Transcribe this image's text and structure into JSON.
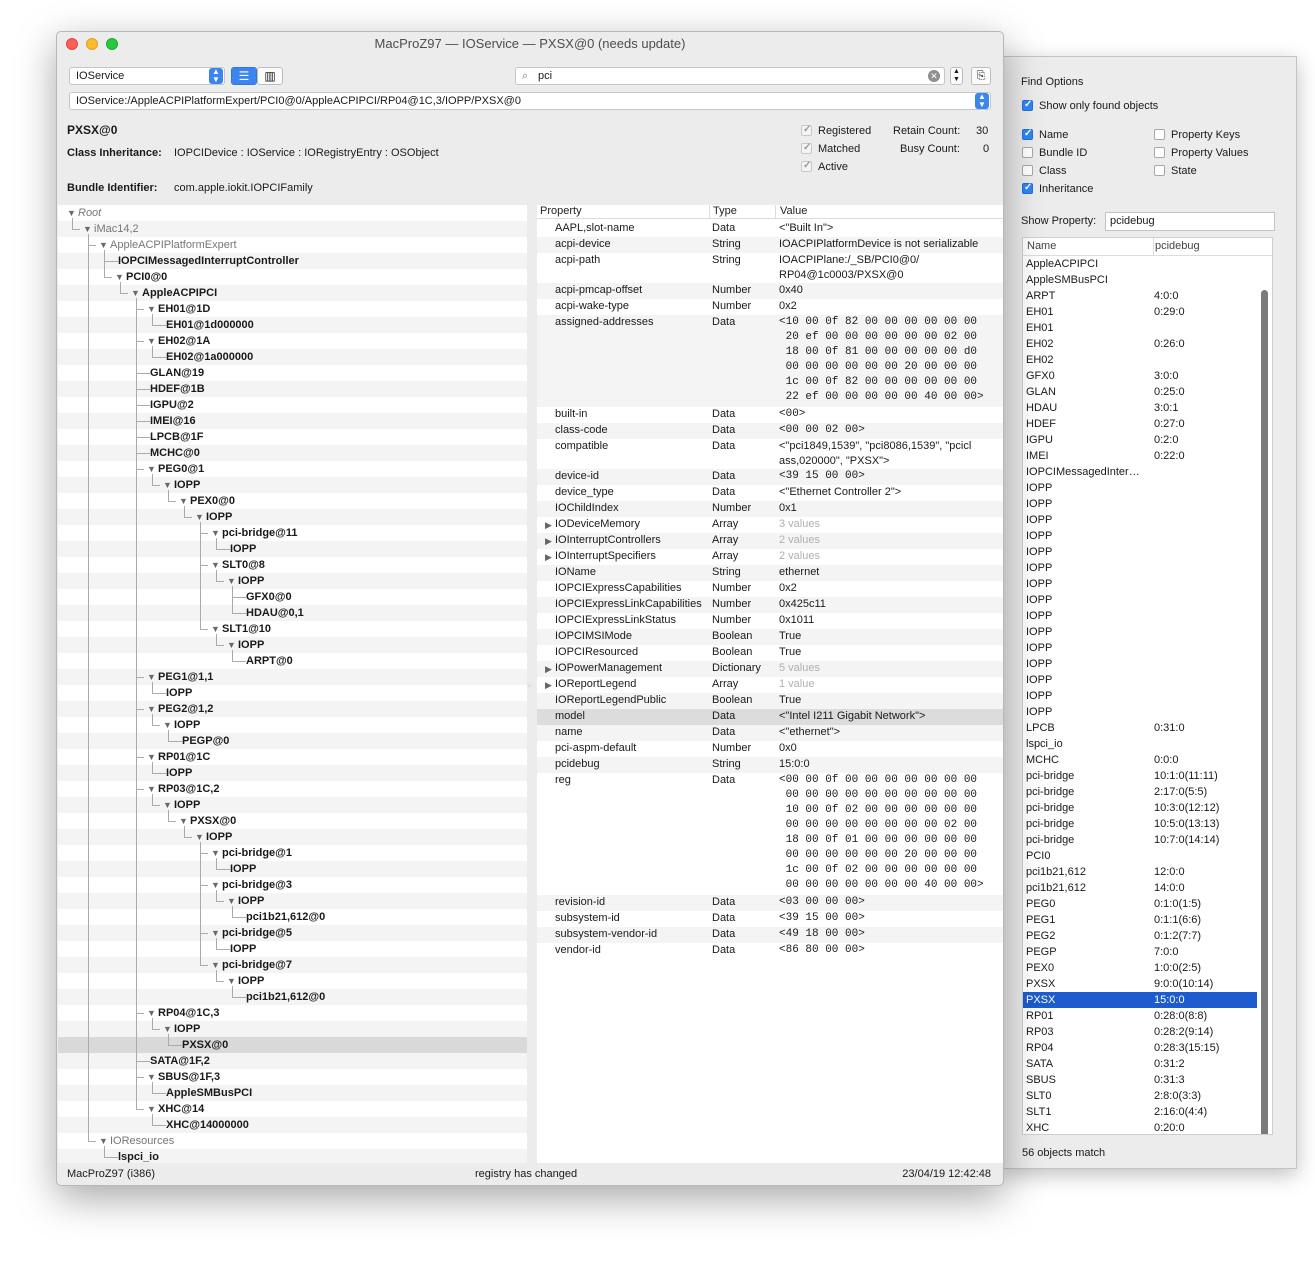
{
  "window": {
    "title": "MacProZ97 — IOService — PXSX@0 (needs update)",
    "plane": "IOService",
    "search": "pci",
    "path": "IOService:/AppleACPIPlatformExpert/PCI0@0/AppleACPIPCI/RP04@1C,3/IOPP/PXSX@0"
  },
  "info": {
    "name": "PXSX@0",
    "inheritance_label": "Class Inheritance:",
    "inheritance": "IOPCIDevice : IOService : IORegistryEntry : OSObject",
    "bundle_label": "Bundle Identifier:",
    "bundle": "com.apple.iokit.IOPCIFamily",
    "registered": "Registered",
    "matched": "Matched",
    "active": "Active",
    "retain_label": "Retain Count:",
    "retain": "30",
    "busy_label": "Busy Count:",
    "busy": "0"
  },
  "tree": [
    {
      "label": "Root",
      "style": "i",
      "indent": 0,
      "open": true
    },
    {
      "label": "iMac14,2",
      "style": "g",
      "indent": 1,
      "open": true
    },
    {
      "label": "AppleACPIPlatformExpert",
      "style": "g",
      "indent": 2,
      "open": true
    },
    {
      "label": "IOPCIMessagedInterruptController",
      "style": "b",
      "indent": 3,
      "open": null
    },
    {
      "label": "PCI0@0",
      "style": "b",
      "indent": 3,
      "open": true
    },
    {
      "label": "AppleACPIPCI",
      "style": "b",
      "indent": 4,
      "open": true
    },
    {
      "label": "EH01@1D",
      "style": "b",
      "indent": 5,
      "open": true
    },
    {
      "label": "EH01@1d000000",
      "style": "b",
      "indent": 6,
      "open": null
    },
    {
      "label": "EH02@1A",
      "style": "b",
      "indent": 5,
      "open": true
    },
    {
      "label": "EH02@1a000000",
      "style": "b",
      "indent": 6,
      "open": null
    },
    {
      "label": "GLAN@19",
      "style": "b",
      "indent": 5,
      "open": null
    },
    {
      "label": "HDEF@1B",
      "style": "b",
      "indent": 5,
      "open": null
    },
    {
      "label": "IGPU@2",
      "style": "b",
      "indent": 5,
      "open": null
    },
    {
      "label": "IMEI@16",
      "style": "b",
      "indent": 5,
      "open": null
    },
    {
      "label": "LPCB@1F",
      "style": "b",
      "indent": 5,
      "open": null
    },
    {
      "label": "MCHC@0",
      "style": "b",
      "indent": 5,
      "open": null
    },
    {
      "label": "PEG0@1",
      "style": "b",
      "indent": 5,
      "open": true
    },
    {
      "label": "IOPP",
      "style": "b",
      "indent": 6,
      "open": true
    },
    {
      "label": "PEX0@0",
      "style": "b",
      "indent": 7,
      "open": true
    },
    {
      "label": "IOPP",
      "style": "b",
      "indent": 8,
      "open": true
    },
    {
      "label": "pci-bridge@11",
      "style": "b",
      "indent": 9,
      "open": true
    },
    {
      "label": "IOPP",
      "style": "b",
      "indent": 10,
      "open": null
    },
    {
      "label": "SLT0@8",
      "style": "b",
      "indent": 9,
      "open": true
    },
    {
      "label": "IOPP",
      "style": "b",
      "indent": 10,
      "open": true
    },
    {
      "label": "GFX0@0",
      "style": "b",
      "indent": 11,
      "open": null
    },
    {
      "label": "HDAU@0,1",
      "style": "b",
      "indent": 11,
      "open": null
    },
    {
      "label": "SLT1@10",
      "style": "b",
      "indent": 9,
      "open": true
    },
    {
      "label": "IOPP",
      "style": "b",
      "indent": 10,
      "open": true
    },
    {
      "label": "ARPT@0",
      "style": "b",
      "indent": 11,
      "open": null
    },
    {
      "label": "PEG1@1,1",
      "style": "b",
      "indent": 5,
      "open": true
    },
    {
      "label": "IOPP",
      "style": "b",
      "indent": 6,
      "open": null
    },
    {
      "label": "PEG2@1,2",
      "style": "b",
      "indent": 5,
      "open": true
    },
    {
      "label": "IOPP",
      "style": "b",
      "indent": 6,
      "open": true
    },
    {
      "label": "PEGP@0",
      "style": "b",
      "indent": 7,
      "open": null
    },
    {
      "label": "RP01@1C",
      "style": "b",
      "indent": 5,
      "open": true
    },
    {
      "label": "IOPP",
      "style": "b",
      "indent": 6,
      "open": null
    },
    {
      "label": "RP03@1C,2",
      "style": "b",
      "indent": 5,
      "open": true
    },
    {
      "label": "IOPP",
      "style": "b",
      "indent": 6,
      "open": true
    },
    {
      "label": "PXSX@0",
      "style": "b",
      "indent": 7,
      "open": true
    },
    {
      "label": "IOPP",
      "style": "b",
      "indent": 8,
      "open": true
    },
    {
      "label": "pci-bridge@1",
      "style": "b",
      "indent": 9,
      "open": true
    },
    {
      "label": "IOPP",
      "style": "b",
      "indent": 10,
      "open": null
    },
    {
      "label": "pci-bridge@3",
      "style": "b",
      "indent": 9,
      "open": true
    },
    {
      "label": "IOPP",
      "style": "b",
      "indent": 10,
      "open": true
    },
    {
      "label": "pci1b21,612@0",
      "style": "b",
      "indent": 11,
      "open": null
    },
    {
      "label": "pci-bridge@5",
      "style": "b",
      "indent": 9,
      "open": true
    },
    {
      "label": "IOPP",
      "style": "b",
      "indent": 10,
      "open": null
    },
    {
      "label": "pci-bridge@7",
      "style": "b",
      "indent": 9,
      "open": true
    },
    {
      "label": "IOPP",
      "style": "b",
      "indent": 10,
      "open": true
    },
    {
      "label": "pci1b21,612@0",
      "style": "b",
      "indent": 11,
      "open": null
    },
    {
      "label": "RP04@1C,3",
      "style": "b",
      "indent": 5,
      "open": true
    },
    {
      "label": "IOPP",
      "style": "b",
      "indent": 6,
      "open": true
    },
    {
      "label": "PXSX@0",
      "style": "b",
      "indent": 7,
      "open": null,
      "selected": true
    },
    {
      "label": "SATA@1F,2",
      "style": "b",
      "indent": 5,
      "open": null
    },
    {
      "label": "SBUS@1F,3",
      "style": "b",
      "indent": 5,
      "open": true
    },
    {
      "label": "AppleSMBusPCI",
      "style": "b",
      "indent": 6,
      "open": null
    },
    {
      "label": "XHC@14",
      "style": "b",
      "indent": 5,
      "open": true
    },
    {
      "label": "XHC@14000000",
      "style": "b",
      "indent": 6,
      "open": null
    },
    {
      "label": "IOResources",
      "style": "g",
      "indent": 2,
      "open": true
    },
    {
      "label": "lspci_io",
      "style": "b",
      "indent": 3,
      "open": null
    }
  ],
  "props_header": {
    "property": "Property",
    "type": "Type",
    "value": "Value"
  },
  "props": [
    {
      "k": "AAPL,slot-name",
      "t": "Data",
      "v": "<\"Built In\">",
      "s": 1,
      "lines": 1
    },
    {
      "k": "acpi-device",
      "t": "String",
      "v": "IOACPIPlatformDevice is not serializable",
      "s": 1,
      "lines": 1
    },
    {
      "k": "acpi-path",
      "t": "String",
      "v": "IOACPIPlane:/_SB/PCI0@0/\nRP04@1c0003/PXSX@0",
      "s": 1,
      "lines": 2
    },
    {
      "k": "acpi-pmcap-offset",
      "t": "Number",
      "v": "0x40",
      "s": 1,
      "lines": 1
    },
    {
      "k": "acpi-wake-type",
      "t": "Number",
      "v": "0x2",
      "s": 1,
      "lines": 1
    },
    {
      "k": "assigned-addresses",
      "t": "Data",
      "v": "<10 00 0f 82 00 00 00 00 00 00\n 20 ef 00 00 00 00 00 00 02 00\n 18 00 0f 81 00 00 00 00 00 d0\n 00 00 00 00 00 00 20 00 00 00\n 1c 00 0f 82 00 00 00 00 00 00\n 22 ef 00 00 00 00 00 40 00 00>",
      "s": 0,
      "lines": 6,
      "pad": 1
    },
    {
      "k": "built-in",
      "t": "Data",
      "v": "<00>",
      "s": 0,
      "lines": 1
    },
    {
      "k": "class-code",
      "t": "Data",
      "v": "<00 00 02 00>",
      "s": 0,
      "lines": 1
    },
    {
      "k": "compatible",
      "t": "Data",
      "v": "<\"pci1849,1539\", \"pci8086,1539\", \"pcicl\nass,020000\", \"PXSX\">",
      "s": 1,
      "lines": 2
    },
    {
      "k": "device-id",
      "t": "Data",
      "v": "<39 15 00 00>",
      "s": 0,
      "lines": 1
    },
    {
      "k": "device_type",
      "t": "Data",
      "v": "<\"Ethernet Controller 2\">",
      "s": 1,
      "lines": 1
    },
    {
      "k": "IOChildIndex",
      "t": "Number",
      "v": "0x1",
      "s": 1,
      "lines": 1
    },
    {
      "k": "IODeviceMemory",
      "t": "Array",
      "v": "3 values",
      "s": 2,
      "lines": 1,
      "expand": true
    },
    {
      "k": "IOInterruptControllers",
      "t": "Array",
      "v": "2 values",
      "s": 2,
      "lines": 1,
      "expand": true
    },
    {
      "k": "IOInterruptSpecifiers",
      "t": "Array",
      "v": "2 values",
      "s": 2,
      "lines": 1,
      "expand": true
    },
    {
      "k": "IOName",
      "t": "String",
      "v": "ethernet",
      "s": 1,
      "lines": 1
    },
    {
      "k": "IOPCIExpressCapabilities",
      "t": "Number",
      "v": "0x2",
      "s": 1,
      "lines": 1
    },
    {
      "k": "IOPCIExpressLinkCapabilities",
      "t": "Number",
      "v": "0x425c11",
      "s": 1,
      "lines": 1
    },
    {
      "k": "IOPCIExpressLinkStatus",
      "t": "Number",
      "v": "0x1011",
      "s": 1,
      "lines": 1
    },
    {
      "k": "IOPCIMSIMode",
      "t": "Boolean",
      "v": "True",
      "s": 1,
      "lines": 1
    },
    {
      "k": "IOPCIResourced",
      "t": "Boolean",
      "v": "True",
      "s": 1,
      "lines": 1
    },
    {
      "k": "IOPowerManagement",
      "t": "Dictionary",
      "v": "5 values",
      "s": 2,
      "lines": 1,
      "expand": true
    },
    {
      "k": "IOReportLegend",
      "t": "Array",
      "v": "1 value",
      "s": 2,
      "lines": 1,
      "expand": true
    },
    {
      "k": "IOReportLegendPublic",
      "t": "Boolean",
      "v": "True",
      "s": 1,
      "lines": 1
    },
    {
      "k": "model",
      "t": "Data",
      "v": "<\"Intel I211 Gigabit Network\">",
      "s": 1,
      "lines": 1,
      "hl": true
    },
    {
      "k": "name",
      "t": "Data",
      "v": "<\"ethernet\">",
      "s": 1,
      "lines": 1
    },
    {
      "k": "pci-aspm-default",
      "t": "Number",
      "v": "0x0",
      "s": 1,
      "lines": 1
    },
    {
      "k": "pcidebug",
      "t": "String",
      "v": "15:0:0",
      "s": 1,
      "lines": 1
    },
    {
      "k": "reg",
      "t": "Data",
      "v": "<00 00 0f 00 00 00 00 00 00 00\n 00 00 00 00 00 00 00 00 00 00\n 10 00 0f 02 00 00 00 00 00 00\n 00 00 00 00 00 00 00 00 02 00\n 18 00 0f 01 00 00 00 00 00 00\n 00 00 00 00 00 00 20 00 00 00\n 1c 00 0f 02 00 00 00 00 00 00\n 00 00 00 00 00 00 00 40 00 00>",
      "s": 0,
      "lines": 8,
      "pad": 1
    },
    {
      "k": "revision-id",
      "t": "Data",
      "v": "<03 00 00 00>",
      "s": 0,
      "lines": 1
    },
    {
      "k": "subsystem-id",
      "t": "Data",
      "v": "<39 15 00 00>",
      "s": 0,
      "lines": 1
    },
    {
      "k": "subsystem-vendor-id",
      "t": "Data",
      "v": "<49 18 00 00>",
      "s": 0,
      "lines": 1
    },
    {
      "k": "vendor-id",
      "t": "Data",
      "v": "<86 80 00 00>",
      "s": 0,
      "lines": 1
    }
  ],
  "status": {
    "left": "MacProZ97 (i386)",
    "center": "registry has changed",
    "right": "23/04/19 12:42:48"
  },
  "find_options": {
    "title": "Find Options",
    "show_only_found": "Show only found objects",
    "name": "Name",
    "bundle_id": "Bundle ID",
    "class": "Class",
    "inheritance": "Inheritance",
    "property_keys": "Property Keys",
    "property_values": "Property Values",
    "state": "State",
    "show_property_label": "Show Property:",
    "show_property": "pcidebug",
    "col_name": "Name",
    "col_value": "pcidebug",
    "match_count": "56 objects match",
    "objects": [
      [
        "AppleACPIPCI",
        ""
      ],
      [
        "AppleSMBusPCI",
        ""
      ],
      [
        "ARPT",
        "4:0:0"
      ],
      [
        "EH01",
        "0:29:0"
      ],
      [
        "EH01",
        ""
      ],
      [
        "EH02",
        "0:26:0"
      ],
      [
        "EH02",
        ""
      ],
      [
        "GFX0",
        "3:0:0"
      ],
      [
        "GLAN",
        "0:25:0"
      ],
      [
        "HDAU",
        "3:0:1"
      ],
      [
        "HDEF",
        "0:27:0"
      ],
      [
        "IGPU",
        "0:2:0"
      ],
      [
        "IMEI",
        "0:22:0"
      ],
      [
        "IOPCIMessagedInter…",
        ""
      ],
      [
        "IOPP",
        ""
      ],
      [
        "IOPP",
        ""
      ],
      [
        "IOPP",
        ""
      ],
      [
        "IOPP",
        ""
      ],
      [
        "IOPP",
        ""
      ],
      [
        "IOPP",
        ""
      ],
      [
        "IOPP",
        ""
      ],
      [
        "IOPP",
        ""
      ],
      [
        "IOPP",
        ""
      ],
      [
        "IOPP",
        ""
      ],
      [
        "IOPP",
        ""
      ],
      [
        "IOPP",
        ""
      ],
      [
        "IOPP",
        ""
      ],
      [
        "IOPP",
        ""
      ],
      [
        "IOPP",
        ""
      ],
      [
        "LPCB",
        "0:31:0"
      ],
      [
        "lspci_io",
        ""
      ],
      [
        "MCHC",
        "0:0:0"
      ],
      [
        "pci-bridge",
        "10:1:0(11:11)"
      ],
      [
        "pci-bridge",
        "2:17:0(5:5)"
      ],
      [
        "pci-bridge",
        "10:3:0(12:12)"
      ],
      [
        "pci-bridge",
        "10:5:0(13:13)"
      ],
      [
        "pci-bridge",
        "10:7:0(14:14)"
      ],
      [
        "PCI0",
        ""
      ],
      [
        "pci1b21,612",
        "12:0:0"
      ],
      [
        "pci1b21,612",
        "14:0:0"
      ],
      [
        "PEG0",
        "0:1:0(1:5)"
      ],
      [
        "PEG1",
        "0:1:1(6:6)"
      ],
      [
        "PEG2",
        "0:1:2(7:7)"
      ],
      [
        "PEGP",
        "7:0:0"
      ],
      [
        "PEX0",
        "1:0:0(2:5)"
      ],
      [
        "PXSX",
        "9:0:0(10:14)"
      ],
      [
        "PXSX",
        "15:0:0"
      ],
      [
        "RP01",
        "0:28:0(8:8)"
      ],
      [
        "RP03",
        "0:28:2(9:14)"
      ],
      [
        "RP04",
        "0:28:3(15:15)"
      ],
      [
        "SATA",
        "0:31:2"
      ],
      [
        "SBUS",
        "0:31:3"
      ],
      [
        "SLT0",
        "2:8:0(3:3)"
      ],
      [
        "SLT1",
        "2:16:0(4:4)"
      ],
      [
        "XHC",
        "0:20:0"
      ],
      [
        "XHC",
        ""
      ]
    ],
    "selected_index": 46
  }
}
